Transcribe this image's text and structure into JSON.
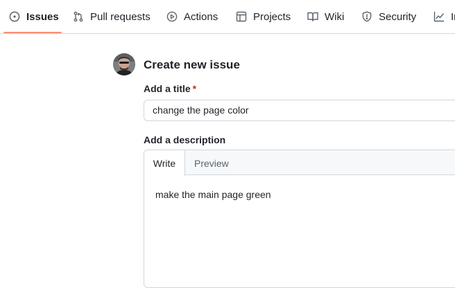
{
  "repo_nav": {
    "tabs": [
      {
        "label": "Issues",
        "icon": "issue-opened-icon",
        "active": true
      },
      {
        "label": "Pull requests",
        "icon": "git-pull-request-icon"
      },
      {
        "label": "Actions",
        "icon": "play-icon"
      },
      {
        "label": "Projects",
        "icon": "table-icon"
      },
      {
        "label": "Wiki",
        "icon": "book-icon"
      },
      {
        "label": "Security",
        "icon": "shield-icon"
      },
      {
        "label": "In",
        "icon": "graph-icon"
      }
    ],
    "active_underline_color": "#fd8c73"
  },
  "issue_form": {
    "heading": "Create new issue",
    "title_label": "Add a title",
    "required_mark": "*",
    "title_value": "change the page color",
    "description_label": "Add a description",
    "tabs": {
      "write": "Write",
      "preview": "Preview"
    },
    "description_value": "make the main page green"
  },
  "colors": {
    "border": "#d0d7de",
    "required": "#cf222e",
    "tabbar_bg": "#f6f8fa"
  }
}
